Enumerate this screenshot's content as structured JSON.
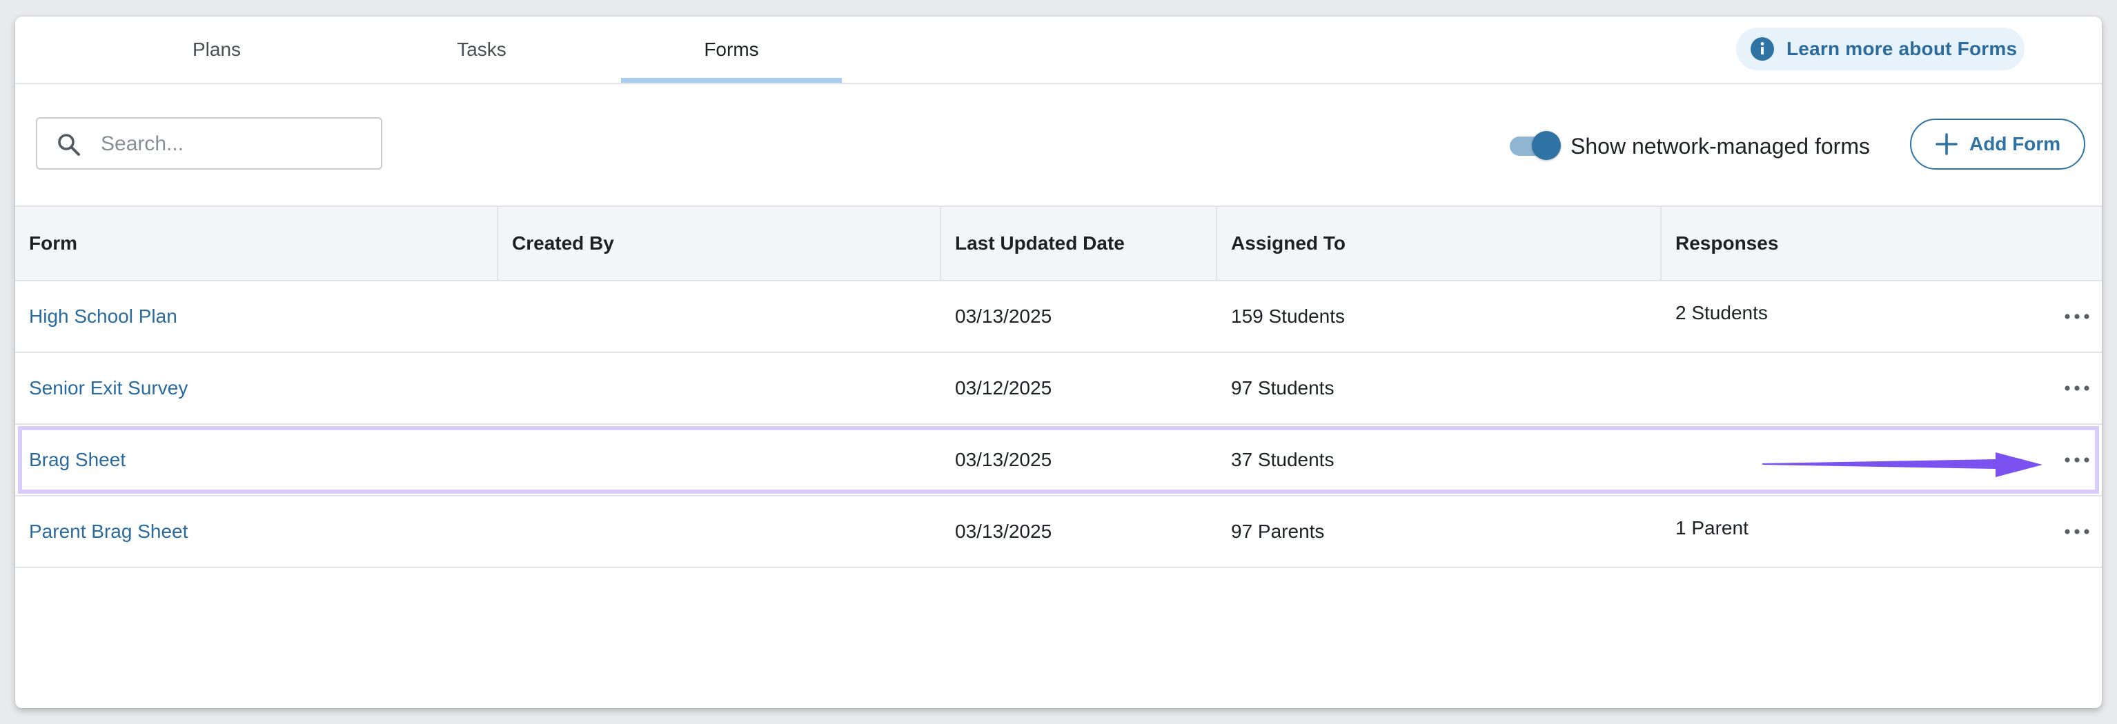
{
  "tabs": [
    {
      "label": "Plans"
    },
    {
      "label": "Tasks"
    },
    {
      "label": "Forms",
      "active": true
    }
  ],
  "learn_more": {
    "label": "Learn more about Forms",
    "icon": "info-icon"
  },
  "search": {
    "placeholder": "Search...",
    "value": "",
    "icon": "search-icon"
  },
  "network_toggle": {
    "label": "Show network-managed forms",
    "on": true
  },
  "add_form": {
    "label": "Add Form",
    "icon": "plus-icon"
  },
  "table": {
    "columns": [
      "Form",
      "Created By",
      "Last Updated Date",
      "Assigned To",
      "Responses"
    ],
    "rows": [
      {
        "form": "High School Plan",
        "created_by": "",
        "last_updated": "03/13/2025",
        "assigned_to": "159 Students",
        "responses": "2 Students"
      },
      {
        "form": "Senior Exit Survey",
        "created_by": "",
        "last_updated": "03/12/2025",
        "assigned_to": "97 Students",
        "responses": ""
      },
      {
        "form": "Brag Sheet",
        "created_by": "",
        "last_updated": "03/13/2025",
        "assigned_to": "37 Students",
        "responses": "",
        "highlighted": true
      },
      {
        "form": "Parent Brag Sheet",
        "created_by": "",
        "last_updated": "03/13/2025",
        "assigned_to": "97 Parents",
        "responses": "1 Parent"
      }
    ]
  },
  "colors": {
    "accent": "#2f73a5",
    "link": "#2a6a9c",
    "tab_indicator": "#a9cdee",
    "highlight_border": "#d7ccfb",
    "annotation_arrow": "#7b52f0"
  }
}
